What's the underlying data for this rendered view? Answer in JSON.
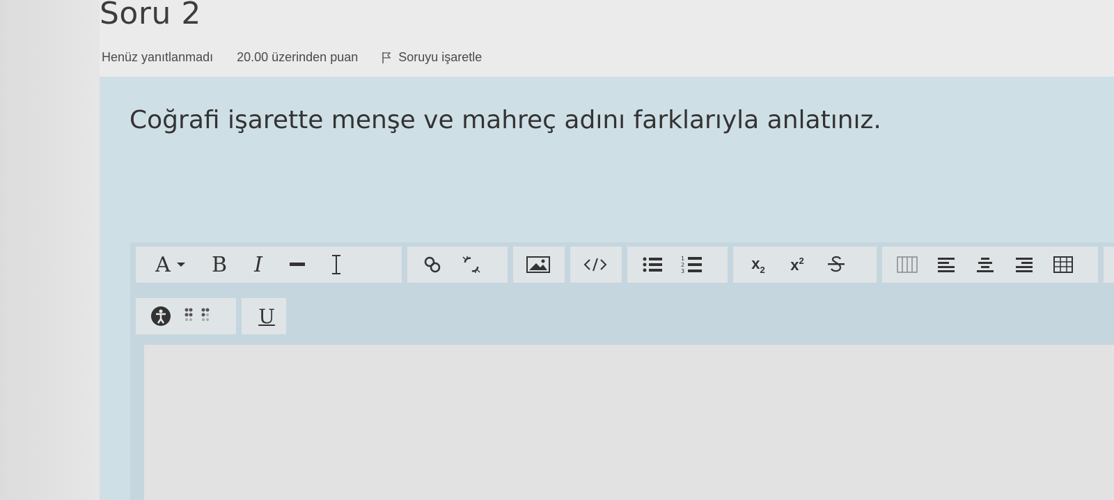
{
  "question": {
    "heading": "Soru 2",
    "status": "Henüz yanıtlanmadı",
    "score": "20.00 üzerinden puan",
    "flag_label": "Soruyu işaretle",
    "text": "Coğrafi işarette menşe ve mahreç adını farklarıyla anlatınız."
  },
  "toolbar": {
    "font_label": "A",
    "bold_label": "B",
    "italic_label": "I",
    "underline_label": "U",
    "subscript_label": "x",
    "subscript_index": "2",
    "superscript_label": "x",
    "superscript_index": "2",
    "icons": [
      "font-color-icon",
      "bold-icon",
      "italic-icon",
      "horizontal-rule-icon",
      "clear-formatting-icon",
      "link-icon",
      "unlink-icon",
      "image-icon",
      "html-code-icon",
      "bullet-list-icon",
      "numbered-list-icon",
      "subscript-icon",
      "superscript-icon",
      "strikethrough-icon",
      "table-icon",
      "align-left-icon",
      "align-center-icon",
      "align-right-icon",
      "insert-table-icon",
      "equation-icon",
      "accessibility-icon",
      "screen-reader-icon",
      "underline-icon"
    ]
  },
  "colors": {
    "panel": "#cfdfe6",
    "editor_toolbar": "#c5d6de",
    "button_group": "#dfe4e7"
  }
}
